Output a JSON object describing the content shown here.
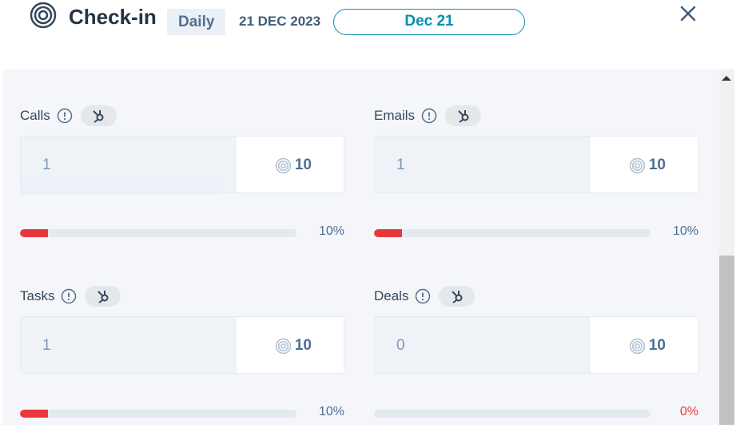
{
  "header": {
    "title": "Check-in",
    "period_badge": "Daily",
    "date_text": "21 DEC 2023",
    "date_pill": "Dec 21"
  },
  "metrics": [
    {
      "label": "Calls",
      "value": "1",
      "target": "10",
      "percent_text": "10%",
      "progress": 0.1
    },
    {
      "label": "Emails",
      "value": "1",
      "target": "10",
      "percent_text": "10%",
      "progress": 0.1
    },
    {
      "label": "Tasks",
      "value": "1",
      "target": "10",
      "percent_text": "10%",
      "progress": 0.1
    },
    {
      "label": "Deals",
      "value": "0",
      "target": "10",
      "percent_text": "0%",
      "progress": 0.0
    }
  ],
  "colors": {
    "accent": "#0091ae",
    "progress": "#e8383d",
    "track": "#e2eaef",
    "panel_bg": "#f4f6f9"
  },
  "icons": {
    "logo": "target-icon",
    "close": "close-icon",
    "info": "info-circle-icon",
    "hub": "hubspot-sprocket-icon"
  }
}
